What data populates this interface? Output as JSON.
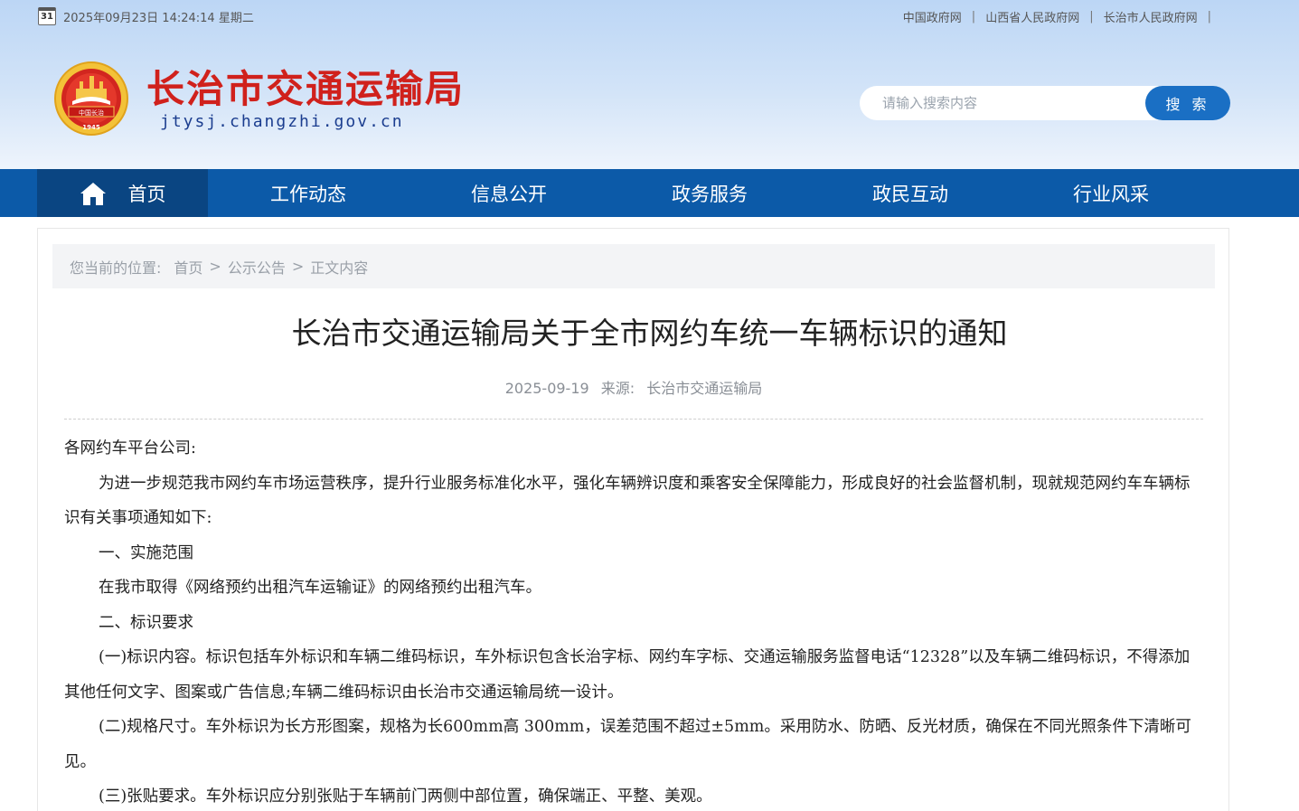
{
  "topbar": {
    "calendar_day": "31",
    "datetime": "2025年09月23日 14:24:14 星期二",
    "links": [
      "中国政府网",
      "山西省人民政府网",
      "长治市人民政府网"
    ],
    "trailing_sep": "|"
  },
  "brand": {
    "title": "长治市交通运输局",
    "domain": "jtysj.changzhi.gov.cn",
    "emblem_banner_text": "中国长治",
    "emblem_year": "1945"
  },
  "search": {
    "placeholder": "请输入搜索内容",
    "button_label": "搜 索"
  },
  "nav": {
    "items": [
      {
        "label": "首页",
        "active": true
      },
      {
        "label": "工作动态"
      },
      {
        "label": "信息公开"
      },
      {
        "label": "政务服务"
      },
      {
        "label": "政民互动"
      },
      {
        "label": "行业风采"
      }
    ]
  },
  "breadcrumb": {
    "prefix": "您当前的位置:",
    "items": [
      "首页",
      "公示公告",
      "正文内容"
    ],
    "separator": ">"
  },
  "article": {
    "title": "长治市交通运输局关于全市网约车统一车辆标识的通知",
    "date": "2025-09-19",
    "source_label": "来源:",
    "source": "长治市交通运输局",
    "paragraphs": [
      "各网约车平台公司:",
      "为进一步规范我市网约车市场运营秩序，提升行业服务标准化水平，强化车辆辨识度和乘客安全保障能力，形成良好的社会监督机制，现就规范网约车车辆标识有关事项通知如下:",
      "一、实施范围",
      "在我市取得《网络预约出租汽车运输证》的网络预约出租汽车。",
      "二、标识要求",
      "(一)标识内容。标识包括车外标识和车辆二维码标识，车外标识包含长治字标、网约车字标、交通运输服务监督电话“12328”以及车辆二维码标识，不得添加其他任何文字、图案或广告信息;车辆二维码标识由长治市交通运输局统一设计。",
      "(二)规格尺寸。车外标识为长方形图案，规格为长600mm高 300mm，误差范围不超过±5mm。采用防水、防晒、反光材质，确保在不同光照条件下清晰可见。",
      "(三)张贴要求。车外标识应分别张贴于车辆前门两侧中部位置，确保端正、平整、美观。"
    ]
  },
  "colors": {
    "nav_bg": "#0c5aa8",
    "nav_active": "#0a4582",
    "brand_red": "#d0211c",
    "search_button": "#1a6fc4"
  }
}
